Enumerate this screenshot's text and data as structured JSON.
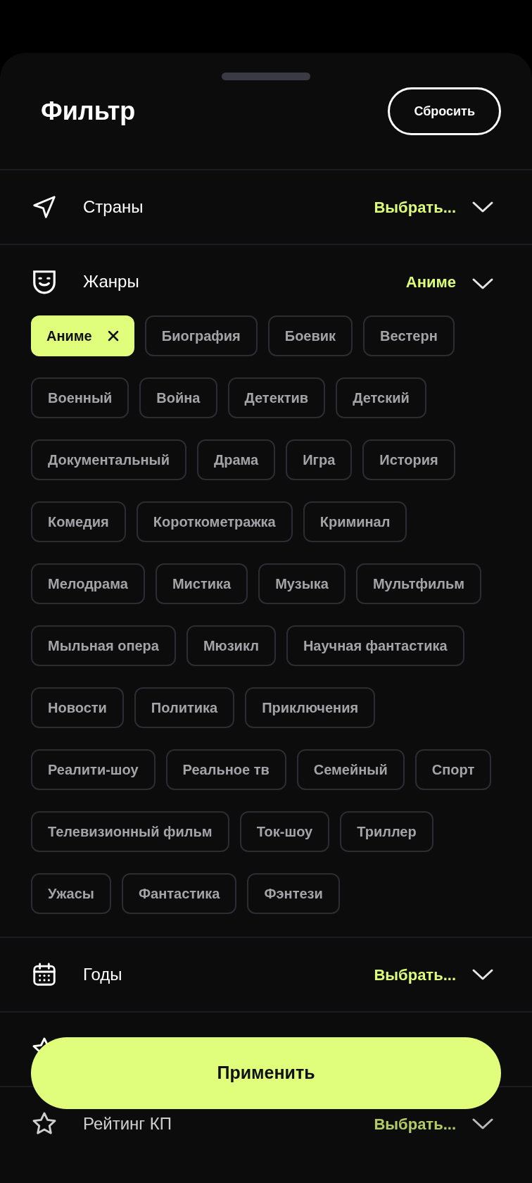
{
  "title": "Фильтр",
  "reset_button": "Сбросить",
  "sections": [
    {
      "kind": "countries",
      "label": "Страны",
      "value": "Выбрать...",
      "expanded": false
    },
    {
      "kind": "genres",
      "label": "Жанры",
      "value": "Аниме",
      "expanded": true,
      "chips": [
        {
          "label": "Аниме",
          "selected": true
        },
        {
          "label": "Биография",
          "selected": false
        },
        {
          "label": "Боевик",
          "selected": false
        },
        {
          "label": "Вестерн",
          "selected": false
        },
        {
          "label": "Военный",
          "selected": false
        },
        {
          "label": "Война",
          "selected": false
        },
        {
          "label": "Детектив",
          "selected": false
        },
        {
          "label": "Детский",
          "selected": false
        },
        {
          "label": "Документальный",
          "selected": false
        },
        {
          "label": "Драма",
          "selected": false
        },
        {
          "label": "Игра",
          "selected": false
        },
        {
          "label": "История",
          "selected": false
        },
        {
          "label": "Комедия",
          "selected": false
        },
        {
          "label": "Короткометражка",
          "selected": false
        },
        {
          "label": "Криминал",
          "selected": false
        },
        {
          "label": "Мелодрама",
          "selected": false
        },
        {
          "label": "Мистика",
          "selected": false
        },
        {
          "label": "Музыка",
          "selected": false
        },
        {
          "label": "Мультфильм",
          "selected": false
        },
        {
          "label": "Мыльная опера",
          "selected": false
        },
        {
          "label": "Мюзикл",
          "selected": false
        },
        {
          "label": "Научная фантастика",
          "selected": false
        },
        {
          "label": "Новости",
          "selected": false
        },
        {
          "label": "Политика",
          "selected": false
        },
        {
          "label": "Приключения",
          "selected": false
        },
        {
          "label": "Реалити-шоу",
          "selected": false
        },
        {
          "label": "Реальное тв",
          "selected": false
        },
        {
          "label": "Семейный",
          "selected": false
        },
        {
          "label": "Спорт",
          "selected": false
        },
        {
          "label": "Телевизионный фильм",
          "selected": false
        },
        {
          "label": "Ток-шоу",
          "selected": false
        },
        {
          "label": "Триллер",
          "selected": false
        },
        {
          "label": "Ужасы",
          "selected": false
        },
        {
          "label": "Фантастика",
          "selected": false
        },
        {
          "label": "Фэнтези",
          "selected": false
        }
      ]
    },
    {
      "kind": "years",
      "label": "Годы",
      "value": "Выбрать...",
      "expanded": false
    },
    {
      "kind": "rating_hidden",
      "expanded": false
    },
    {
      "kind": "rating_faded",
      "label": "Рейтинг КП",
      "value": "Выбрать...",
      "expanded": false
    }
  ],
  "apply_button": "Применить"
}
